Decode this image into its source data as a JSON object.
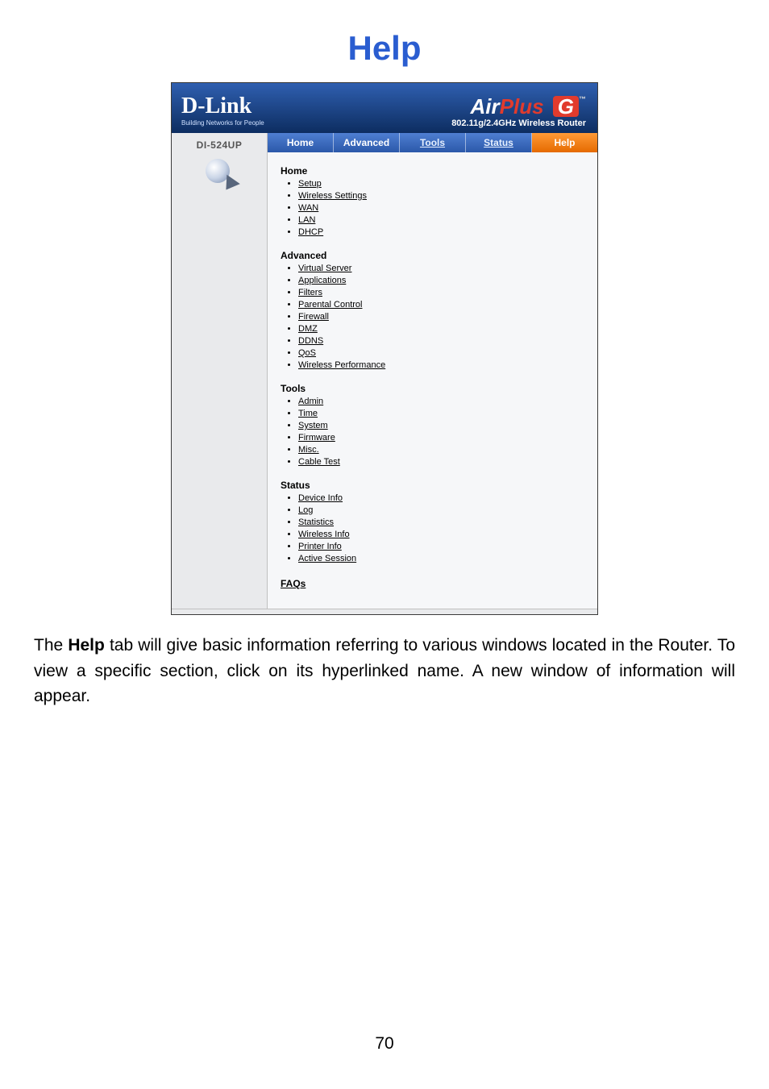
{
  "page": {
    "title": "Help",
    "number": "70",
    "description_pre": "The ",
    "description_bold": "Help",
    "description_post": " tab will give basic information referring to various windows located in the Router. To view a specific section, click on its hyperlinked name. A new window of information will appear."
  },
  "router_ui": {
    "brand": "D-Link",
    "brand_sub": "Building Networks for People",
    "product_air": "Air",
    "product_plus": "Plus ",
    "product_g": "G",
    "product_tm": "™",
    "product_sub": "802.11g/2.4GHz Wireless Router",
    "model": "DI-524UP",
    "tabs": [
      {
        "label": "Home",
        "style": "blue",
        "underline": false
      },
      {
        "label": "Advanced",
        "style": "blue",
        "underline": false
      },
      {
        "label": "Tools",
        "style": "blue",
        "underline": true
      },
      {
        "label": "Status",
        "style": "blue",
        "underline": true
      },
      {
        "label": "Help",
        "style": "orange",
        "underline": false
      }
    ],
    "sections": [
      {
        "title": "Home",
        "items": [
          "Setup",
          "Wireless Settings",
          "WAN",
          "LAN",
          "DHCP"
        ]
      },
      {
        "title": "Advanced",
        "items": [
          "Virtual Server",
          "Applications",
          "Filters",
          "Parental Control",
          "Firewall",
          "DMZ",
          "DDNS",
          "QoS",
          "Wireless Performance"
        ]
      },
      {
        "title": "Tools",
        "items": [
          "Admin",
          "Time",
          "System",
          "Firmware",
          "Misc.",
          "Cable Test"
        ]
      },
      {
        "title": "Status",
        "items": [
          "Device Info",
          "Log",
          "Statistics",
          "Wireless Info",
          "Printer Info",
          "Active Session"
        ]
      }
    ],
    "faqs_label": "FAQs"
  }
}
